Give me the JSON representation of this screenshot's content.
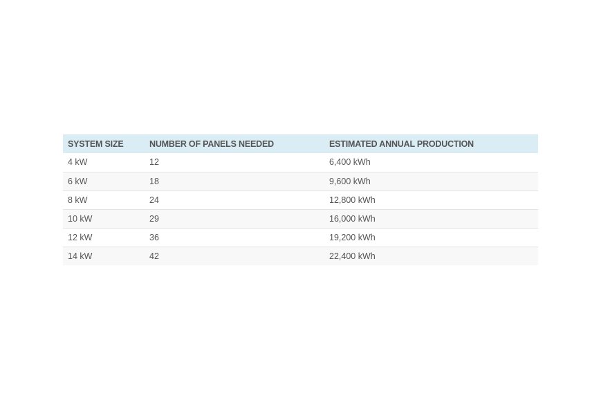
{
  "table": {
    "headers": [
      "SYSTEM SIZE",
      "NUMBER OF PANELS NEEDED",
      "ESTIMATED ANNUAL PRODUCTION"
    ],
    "rows": [
      [
        "4 kW",
        "12",
        "6,400 kWh"
      ],
      [
        "6 kW",
        "18",
        "9,600 kWh"
      ],
      [
        "8 kW",
        "24",
        "12,800 kWh"
      ],
      [
        "10 kW",
        "29",
        "16,000 kWh"
      ],
      [
        "12 kW",
        "36",
        "19,200 kWh"
      ],
      [
        "14 kW",
        "42",
        "22,400 kWh"
      ]
    ]
  },
  "colors": {
    "header_background": "#daedf5",
    "text": "#555555",
    "row_alt_background": "#f8f8f8",
    "row_divider": "#e4e4e4"
  }
}
